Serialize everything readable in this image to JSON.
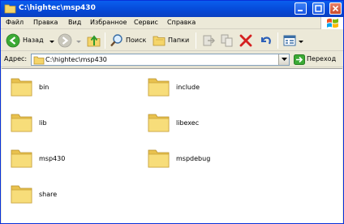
{
  "window": {
    "title": "C:\\hightec\\msp430"
  },
  "menu": [
    "Файл",
    "Правка",
    "Вид",
    "Избранное",
    "Сервис",
    "Справка"
  ],
  "toolbar": {
    "back_label": "Назад",
    "search_label": "Поиск",
    "folders_label": "Папки"
  },
  "address": {
    "label": "Адрес:",
    "value": "C:\\hightec\\msp430",
    "go_label": "Переход"
  },
  "folders": [
    "bin",
    "include",
    "lib",
    "libexec",
    "msp430",
    "mspdebug",
    "share"
  ],
  "colors": {
    "titlebar": "#0548D6",
    "chrome": "#ECE9D8",
    "folder": "#F5D56A",
    "close": "#C94B2D"
  }
}
